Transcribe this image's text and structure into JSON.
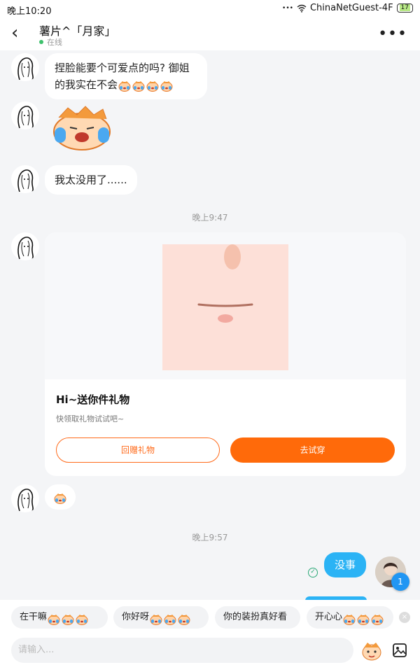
{
  "statusbar": {
    "time": "晚上10:20",
    "dots": "•••",
    "network": "ChinaNetGuest-4F",
    "battery": "17"
  },
  "header": {
    "back": "‹",
    "title": "薯片^「月家」",
    "status": "在线",
    "more": "•••"
  },
  "messages": {
    "m1_line1": "捏脸能要个可爱点的吗? 御姐",
    "m1_line2": "的我实在不会",
    "m3": "我太没用了......",
    "time1": "晚上9:47",
    "card_title": "Hi~送你件礼物",
    "card_sub": "快领取礼物试试吧~",
    "card_btn_left": "回赠礼物",
    "card_btn_right": "去试穿",
    "time2": "晚上9:57",
    "sent1": "没事",
    "badge": "1",
    "check": "✓"
  },
  "quick_replies": [
    "在干嘛",
    "你好呀",
    "你的装扮真好看",
    "开心心"
  ],
  "quick_close": "×",
  "input": {
    "placeholder": "请输入..."
  },
  "colors": {
    "accent_orange": "#ff6a0a",
    "sent_blue": "#2bb3f5",
    "online_green": "#3ec16c",
    "badge_blue": "#2196f3"
  },
  "icons": [
    "back-arrow-icon",
    "more-dots-icon",
    "wifi-icon",
    "crying-emoji-icon",
    "sticker-icon",
    "emoji-button-icon",
    "image-button-icon"
  ]
}
